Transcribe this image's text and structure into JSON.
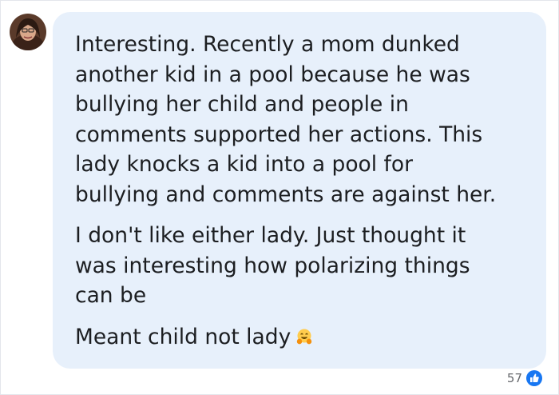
{
  "comment": {
    "paragraphs": [
      "Interesting. Recently a mom dunked\nanother kid in a pool because he was\nbullying her child and people in\ncomments supported her actions. This\nlady knocks a kid into a pool for\nbullying and comments are against her.",
      "I don't like either lady. Just thought it\nwas interesting how polarizing things\ncan be",
      "Meant child not lady"
    ],
    "emoji": "hugging-face"
  },
  "reactions": {
    "count": "57",
    "icon": "like-icon",
    "color": "#1877f2"
  },
  "colors": {
    "bubble": "#e7f0fb",
    "text": "#1c1e21",
    "meta": "#65676b"
  }
}
